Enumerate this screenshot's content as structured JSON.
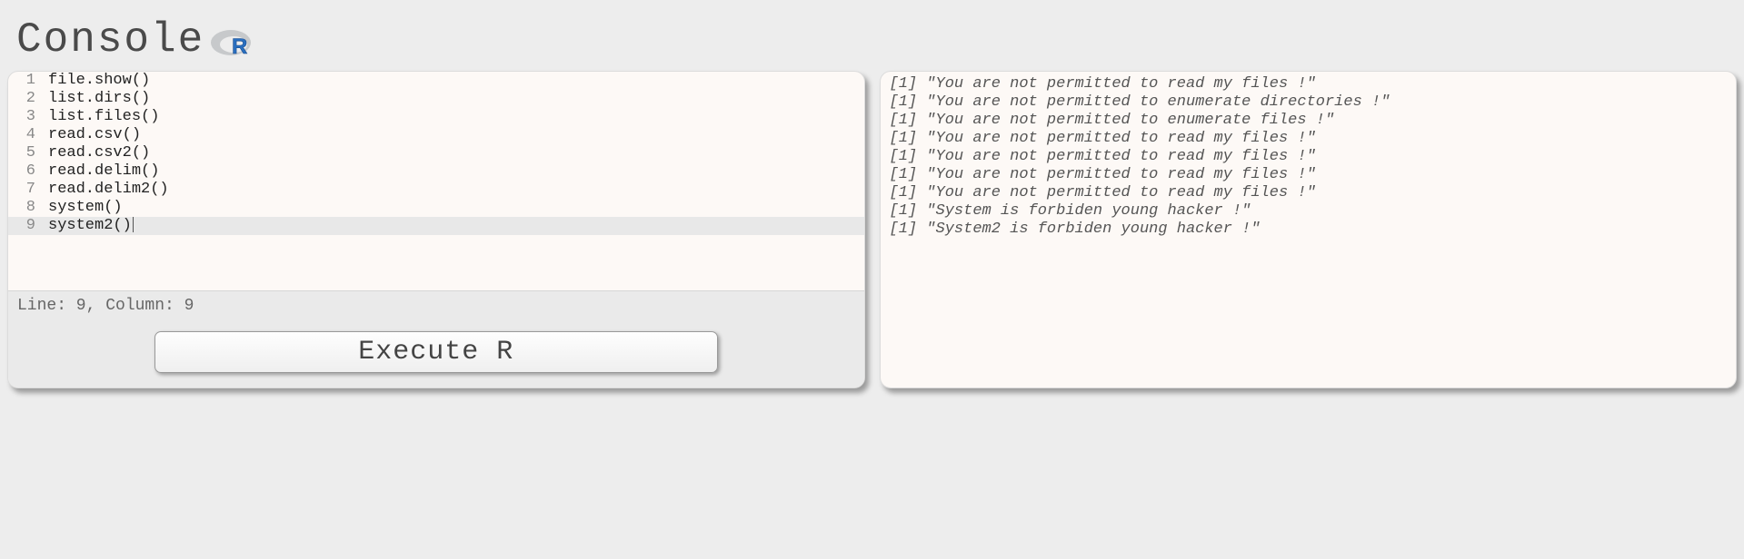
{
  "header": {
    "title": "Console"
  },
  "editor": {
    "lines": [
      {
        "n": "1",
        "code": "file.show()"
      },
      {
        "n": "2",
        "code": "list.dirs()"
      },
      {
        "n": "3",
        "code": "list.files()"
      },
      {
        "n": "4",
        "code": "read.csv()"
      },
      {
        "n": "5",
        "code": "read.csv2()"
      },
      {
        "n": "6",
        "code": "read.delim()"
      },
      {
        "n": "7",
        "code": "read.delim2()"
      },
      {
        "n": "8",
        "code": "system()"
      },
      {
        "n": "9",
        "code": "system2()"
      }
    ],
    "active_line_index": 8,
    "status": "Line: 9, Column: 9",
    "execute_label": "Execute R"
  },
  "output": {
    "lines": [
      "[1] \"You are not permitted to read my files !\"",
      "[1] \"You are not permitted to enumerate directories !\"",
      "[1] \"You are not permitted to enumerate files !\"",
      "[1] \"You are not permitted to read my files !\"",
      "[1] \"You are not permitted to read my files !\"",
      "[1] \"You are not permitted to read my files !\"",
      "[1] \"You are not permitted to read my files !\"",
      "[1] \"System is forbiden young hacker !\"",
      "[1] \"System2 is forbiden young hacker !\""
    ]
  }
}
